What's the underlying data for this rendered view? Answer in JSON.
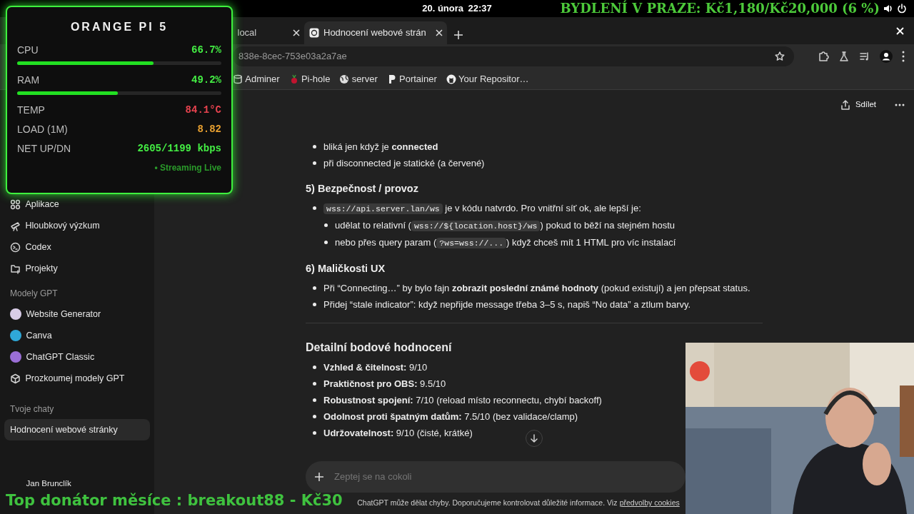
{
  "system_bar": {
    "date": "20. února",
    "time": "22:37"
  },
  "stream_banner": "BYDLENÍ V PRAZE: Kč1,180/Kč20,000 (6 %)",
  "browser": {
    "tabs": [
      {
        "label": "local",
        "selected": false
      },
      {
        "label": "Hodnocení webové strán",
        "selected": true
      }
    ],
    "url": "838e-8cec-753e03a2a7ae",
    "bookmarks": [
      {
        "label": "Adminer",
        "kind": "database"
      },
      {
        "label": "Pi-hole",
        "kind": "berry"
      },
      {
        "label": "server",
        "kind": "globe"
      },
      {
        "label": "Portainer",
        "kind": "letter"
      },
      {
        "label": "Your Repositor…",
        "kind": "cat"
      }
    ]
  },
  "sidebar": {
    "items": [
      {
        "label": "Aplikace",
        "kind": "apps"
      },
      {
        "label": "Hloubkový výzkum",
        "kind": "telescope"
      },
      {
        "label": "Codex",
        "kind": "terminal"
      },
      {
        "label": "Projekty",
        "kind": "folder"
      }
    ],
    "gpts_heading": "Modely GPT",
    "gpts": [
      {
        "label": "Website Generator",
        "kind": "avatar",
        "color": "#d9cde8"
      },
      {
        "label": "Canva",
        "kind": "avatar",
        "color": "#2fa8d8"
      },
      {
        "label": "ChatGPT Classic",
        "kind": "avatar",
        "color": "#9b6fd6"
      },
      {
        "label": "Prozkoumej modely GPT",
        "kind": "cube"
      }
    ],
    "chats_heading": "Tvoje chaty",
    "chats": [
      {
        "title": "Hodnocení webové stránky",
        "selected": true
      }
    ],
    "user": "Jan Brunclík"
  },
  "header": {
    "share": "Sdílet"
  },
  "message": [
    {
      "kind": "list",
      "items": [
        {
          "parts": [
            {
              "kind": "text",
              "text": "bliká jen když je **connected**"
            }
          ]
        },
        {
          "parts": [
            {
              "kind": "text",
              "text": "při disconnected je statické (a červené)"
            }
          ]
        }
      ]
    },
    {
      "kind": "heading",
      "text": "5) Bezpečnost / provoz"
    },
    {
      "kind": "list",
      "items": [
        {
          "parts": [
            {
              "kind": "code",
              "text": "wss://api.server.lan/ws"
            },
            {
              "kind": "text",
              "text": " je v kódu natvrdo. Pro vnitřní síť ok, ale lepší je:"
            }
          ],
          "children": [
            {
              "parts": [
                {
                  "kind": "text",
                  "text": "udělat to relativní ("
                },
                {
                  "kind": "code",
                  "text": "wss://${location.host}/ws"
                },
                {
                  "kind": "text",
                  "text": ") pokud to běží na stejném hostu"
                }
              ]
            },
            {
              "parts": [
                {
                  "kind": "text",
                  "text": "nebo přes query param ("
                },
                {
                  "kind": "code",
                  "text": "?ws=wss://..."
                },
                {
                  "kind": "text",
                  "text": ") když chceš mít 1 HTML pro víc instalací"
                }
              ]
            }
          ]
        }
      ]
    },
    {
      "kind": "heading",
      "text": "6) Maličkosti UX"
    },
    {
      "kind": "list",
      "items": [
        {
          "parts": [
            {
              "kind": "text",
              "text": "Při “Connecting…” by bylo fajn **zobrazit poslední známé hodnoty** (pokud existují) a jen přepsat status."
            }
          ]
        },
        {
          "parts": [
            {
              "kind": "text",
              "text": "Přidej “stale indicator”: když nepřijde message třeba 3–5 s, napiš “No data” a ztlum barvy."
            }
          ]
        }
      ]
    },
    {
      "kind": "divider"
    },
    {
      "kind": "title",
      "text": "Detailní bodové hodnocení"
    },
    {
      "kind": "list",
      "items": [
        {
          "parts": [
            {
              "kind": "text",
              "text": "**Vzhled & čitelnost:** 9/10"
            }
          ]
        },
        {
          "parts": [
            {
              "kind": "text",
              "text": "**Praktičnost pro OBS:** 9.5/10"
            }
          ]
        },
        {
          "parts": [
            {
              "kind": "text",
              "text": "**Robustnost spojení:** 7/10 (reload místo reconnectu, chybí backoff)"
            }
          ]
        },
        {
          "parts": [
            {
              "kind": "text",
              "text": "**Odolnost proti špatným datům:** 7.5/10 (bez validace/clamp)"
            }
          ]
        },
        {
          "parts": [
            {
              "kind": "text",
              "text": "**Udržovatelnost:** 9/10 (čisté, krátké)"
            }
          ]
        }
      ]
    }
  ],
  "composer": {
    "placeholder": "Zeptej se na cokoli"
  },
  "footer": {
    "text": "ChatGPT může dělat chyby. Doporučujeme kontrolovat důležité informace. Viz",
    "link": "předvolby cookies"
  },
  "monitor": {
    "title": "ORANGE PI 5",
    "stats": [
      {
        "label": "CPU",
        "value": "66.7%",
        "color": "#44ee44",
        "level": 0.667
      },
      {
        "label": "RAM",
        "value": "49.2%",
        "color": "#44ee44",
        "level": 0.492
      },
      {
        "label": "TEMP",
        "value": "84.1°C",
        "color": "#e8434f"
      },
      {
        "label": "LOAD (1M)",
        "value": "8.82",
        "color": "#e8a030"
      },
      {
        "label": "NET UP/DN",
        "value": "2605/1199 kbps",
        "color": "#44ee44"
      }
    ],
    "status": "• Streaming Live"
  },
  "donor_banner": "Top donátor měsíce : breakout88 - Kč30"
}
